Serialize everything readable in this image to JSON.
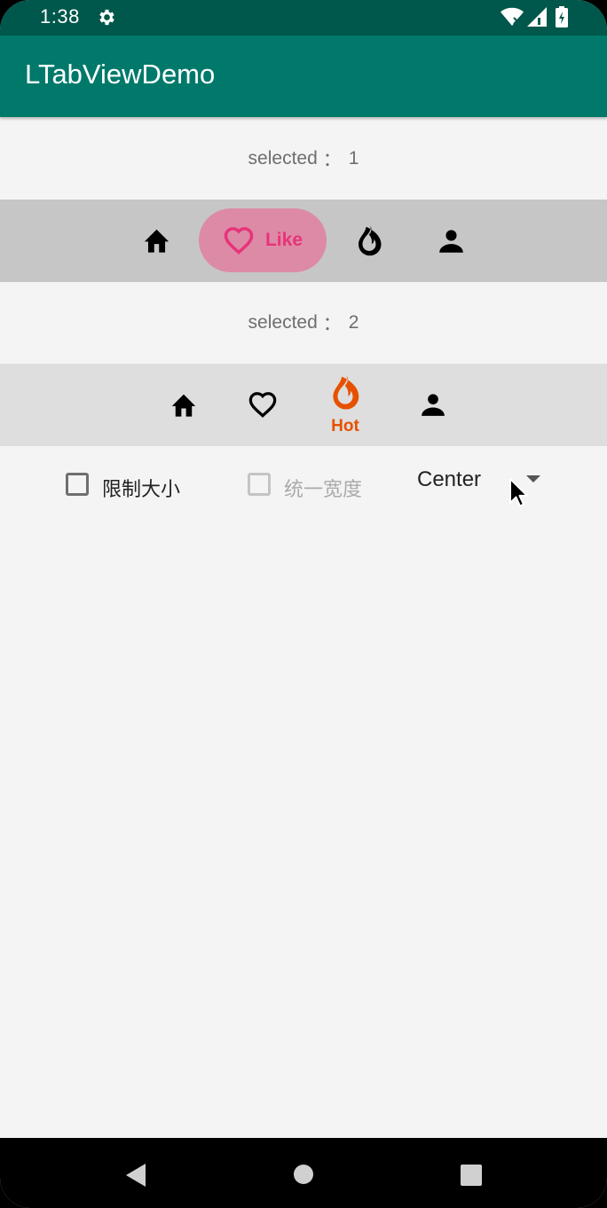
{
  "status_bar": {
    "time": "1:38",
    "icons": [
      "gear-icon",
      "wifi-icon",
      "signal-icon",
      "battery-icon"
    ]
  },
  "app_bar": {
    "title": "LTabViewDemo",
    "color": "#00796b"
  },
  "section1": {
    "selected_label": "selected",
    "separator": "：",
    "selected_value": "1",
    "tabs": [
      {
        "icon": "home-icon",
        "label": ""
      },
      {
        "icon": "heart-icon",
        "label": "Like",
        "active": true,
        "active_color": "#e8337a"
      },
      {
        "icon": "fire-icon",
        "label": ""
      },
      {
        "icon": "person-icon",
        "label": ""
      }
    ]
  },
  "section2": {
    "selected_label": "selected",
    "separator": "：",
    "selected_value": "2",
    "tabs": [
      {
        "icon": "home-icon",
        "label": ""
      },
      {
        "icon": "heart-outline-icon",
        "label": ""
      },
      {
        "icon": "fire-icon",
        "label": "Hot",
        "active": true,
        "active_color": "#e65100"
      },
      {
        "icon": "person-icon",
        "label": ""
      }
    ]
  },
  "options": {
    "limit_size_label": "限制大小",
    "limit_size_checked": false,
    "uniform_width_label": "统一宽度",
    "uniform_width_checked": false,
    "uniform_width_enabled": false,
    "gravity_value": "Center"
  },
  "nav_bar": {
    "buttons": [
      "back-icon",
      "home-circle-icon",
      "recents-icon"
    ]
  }
}
